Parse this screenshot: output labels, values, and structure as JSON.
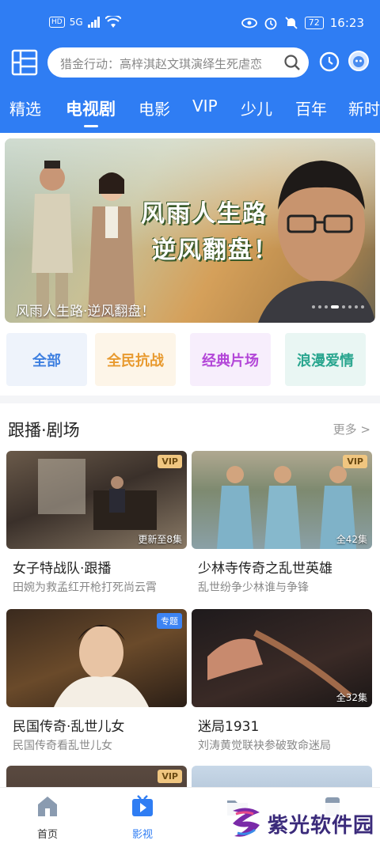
{
  "status_bar": {
    "hd": "HD",
    "signal": "5G",
    "battery": "72",
    "time": "16:23"
  },
  "search": {
    "placeholder": "猎金行动：高梓淇赵文琪演绎生死虐恋"
  },
  "tabs": [
    {
      "label": "精选"
    },
    {
      "label": "电视剧"
    },
    {
      "label": "电影"
    },
    {
      "label": "VIP"
    },
    {
      "label": "少儿"
    },
    {
      "label": "百年"
    },
    {
      "label": "新时"
    }
  ],
  "active_tab": "电视剧",
  "banner": {
    "title_line1": "风雨人生路",
    "title_line2": "逆风翻盘！",
    "caption": "风雨人生路·逆风翻盘！"
  },
  "categories": [
    {
      "label": "全部",
      "color": "#3d7fe0",
      "bg": "#eef3fb"
    },
    {
      "label": "全民抗战",
      "color": "#e89a2f",
      "bg": "#fdf5e8"
    },
    {
      "label": "经典片场",
      "color": "#b346d8",
      "bg": "#f7eefc"
    },
    {
      "label": "浪漫爱情",
      "color": "#2aa68f",
      "bg": "#e9f6f3"
    }
  ],
  "section": {
    "title": "跟播·剧场",
    "more": "更多 >"
  },
  "cards": [
    {
      "title": "女子特战队·跟播",
      "subtitle": "田婉为救孟红开枪打死尚云霄",
      "badge": "VIP",
      "badge_type": "vip",
      "episodes": "更新至8集"
    },
    {
      "title": "少林寺传奇之乱世英雄",
      "subtitle": "乱世纷争少林谁与争锋",
      "badge": "VIP",
      "badge_type": "vip",
      "episodes": "全42集"
    },
    {
      "title": "民国传奇·乱世儿女",
      "subtitle": "民国传奇看乱世儿女",
      "badge": "专题",
      "badge_type": "topic",
      "episodes": ""
    },
    {
      "title": "迷局1931",
      "subtitle": "刘涛黄觉联袂参破致命迷局",
      "badge": "",
      "badge_type": "",
      "episodes": "全32集"
    },
    {
      "title": "",
      "subtitle": "",
      "badge": "VIP",
      "badge_type": "vip",
      "episodes": ""
    },
    {
      "title": "",
      "subtitle": "",
      "badge": "",
      "badge_type": "",
      "episodes": ""
    }
  ],
  "bottom_nav": [
    {
      "label": "首页",
      "icon": "home-icon"
    },
    {
      "label": "影视",
      "icon": "tv-icon"
    }
  ],
  "watermark": {
    "text": "紫光软件园"
  },
  "colors": {
    "brand_blue": "#2f7df3",
    "vip_gold": "#f0c680"
  }
}
